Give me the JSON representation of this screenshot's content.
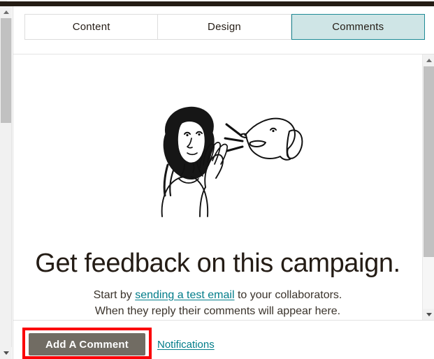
{
  "window": {
    "top_bar_color": "#241c14"
  },
  "tabs": [
    {
      "label": "Content",
      "active": false
    },
    {
      "label": "Design",
      "active": false
    },
    {
      "label": "Comments",
      "active": true
    }
  ],
  "content": {
    "illustration_name": "woman-listening-to-dog-illustration",
    "title": "Get feedback on this campaign.",
    "sub_line1_before": "Start by ",
    "sub_line1_link": "sending a test email",
    "sub_line1_after": " to your collaborators.",
    "sub_line2": "When they reply their comments will appear here."
  },
  "footer": {
    "add_comment_label": "Add A Comment",
    "notifications_label": "Notifications"
  },
  "colors": {
    "accent_teal": "#007c89",
    "active_tab_fill": "#cfe5e6",
    "active_tab_border": "#1e8b96",
    "button_fill": "#716c63",
    "highlight_red": "#fb0007",
    "link_teal": "#007c89"
  },
  "scrollbars": {
    "outer_up_icon": "triangle-up-icon",
    "outer_down_icon": "triangle-down-icon",
    "inner_up_icon": "triangle-up-icon",
    "inner_down_icon": "triangle-down-icon"
  }
}
